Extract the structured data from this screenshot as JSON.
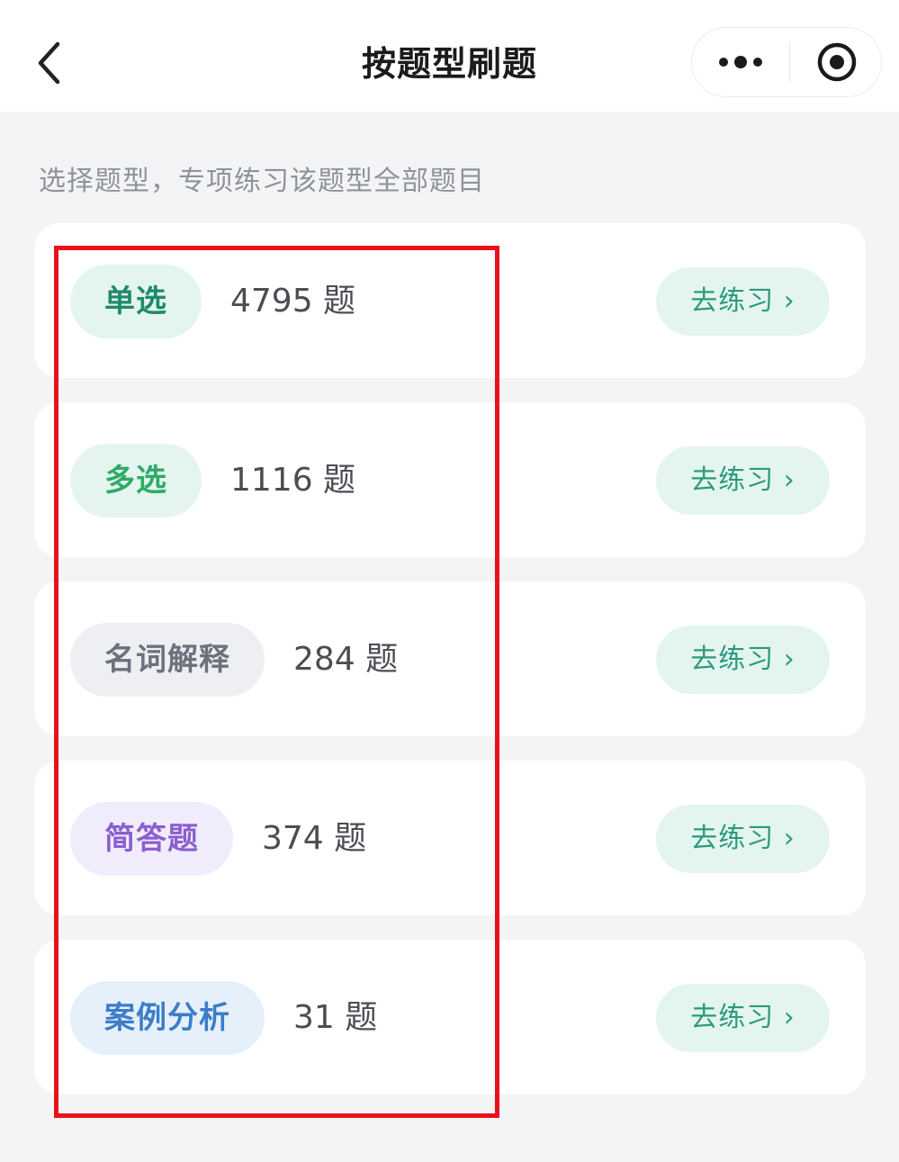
{
  "nav": {
    "title": "按题型刷题",
    "back_icon": "chevron-left-icon",
    "more_icon": "more-dots-icon",
    "close_icon": "target-circle-icon"
  },
  "hint": "选择题型，专项练习该题型全部题目",
  "categories": [
    {
      "label": "单选",
      "count": "4795 题",
      "button": "去练习 ›",
      "tag_bg": "#e4f5ef",
      "tag_color": "#1f8a6b"
    },
    {
      "label": "多选",
      "count": "1116 题",
      "button": "去练习 ›",
      "tag_bg": "#e4f5ef",
      "tag_color": "#2faa68"
    },
    {
      "label": "名词解释",
      "count": "284 题",
      "button": "去练习 ›",
      "tag_bg": "#edeff3",
      "tag_color": "#6b727c"
    },
    {
      "label": "简答题",
      "count": "374 题",
      "button": "去练习 ›",
      "tag_bg": "#f1ecfb",
      "tag_color": "#8a5fd0"
    },
    {
      "label": "案例分析",
      "count": "31 题",
      "button": "去练习 ›",
      "tag_bg": "#e6f0fb",
      "tag_color": "#3c7dc8"
    }
  ],
  "colors": {
    "accent": "#2c9a7c",
    "button_bg": "#e4f5ef",
    "highlight": "#e8121c"
  }
}
